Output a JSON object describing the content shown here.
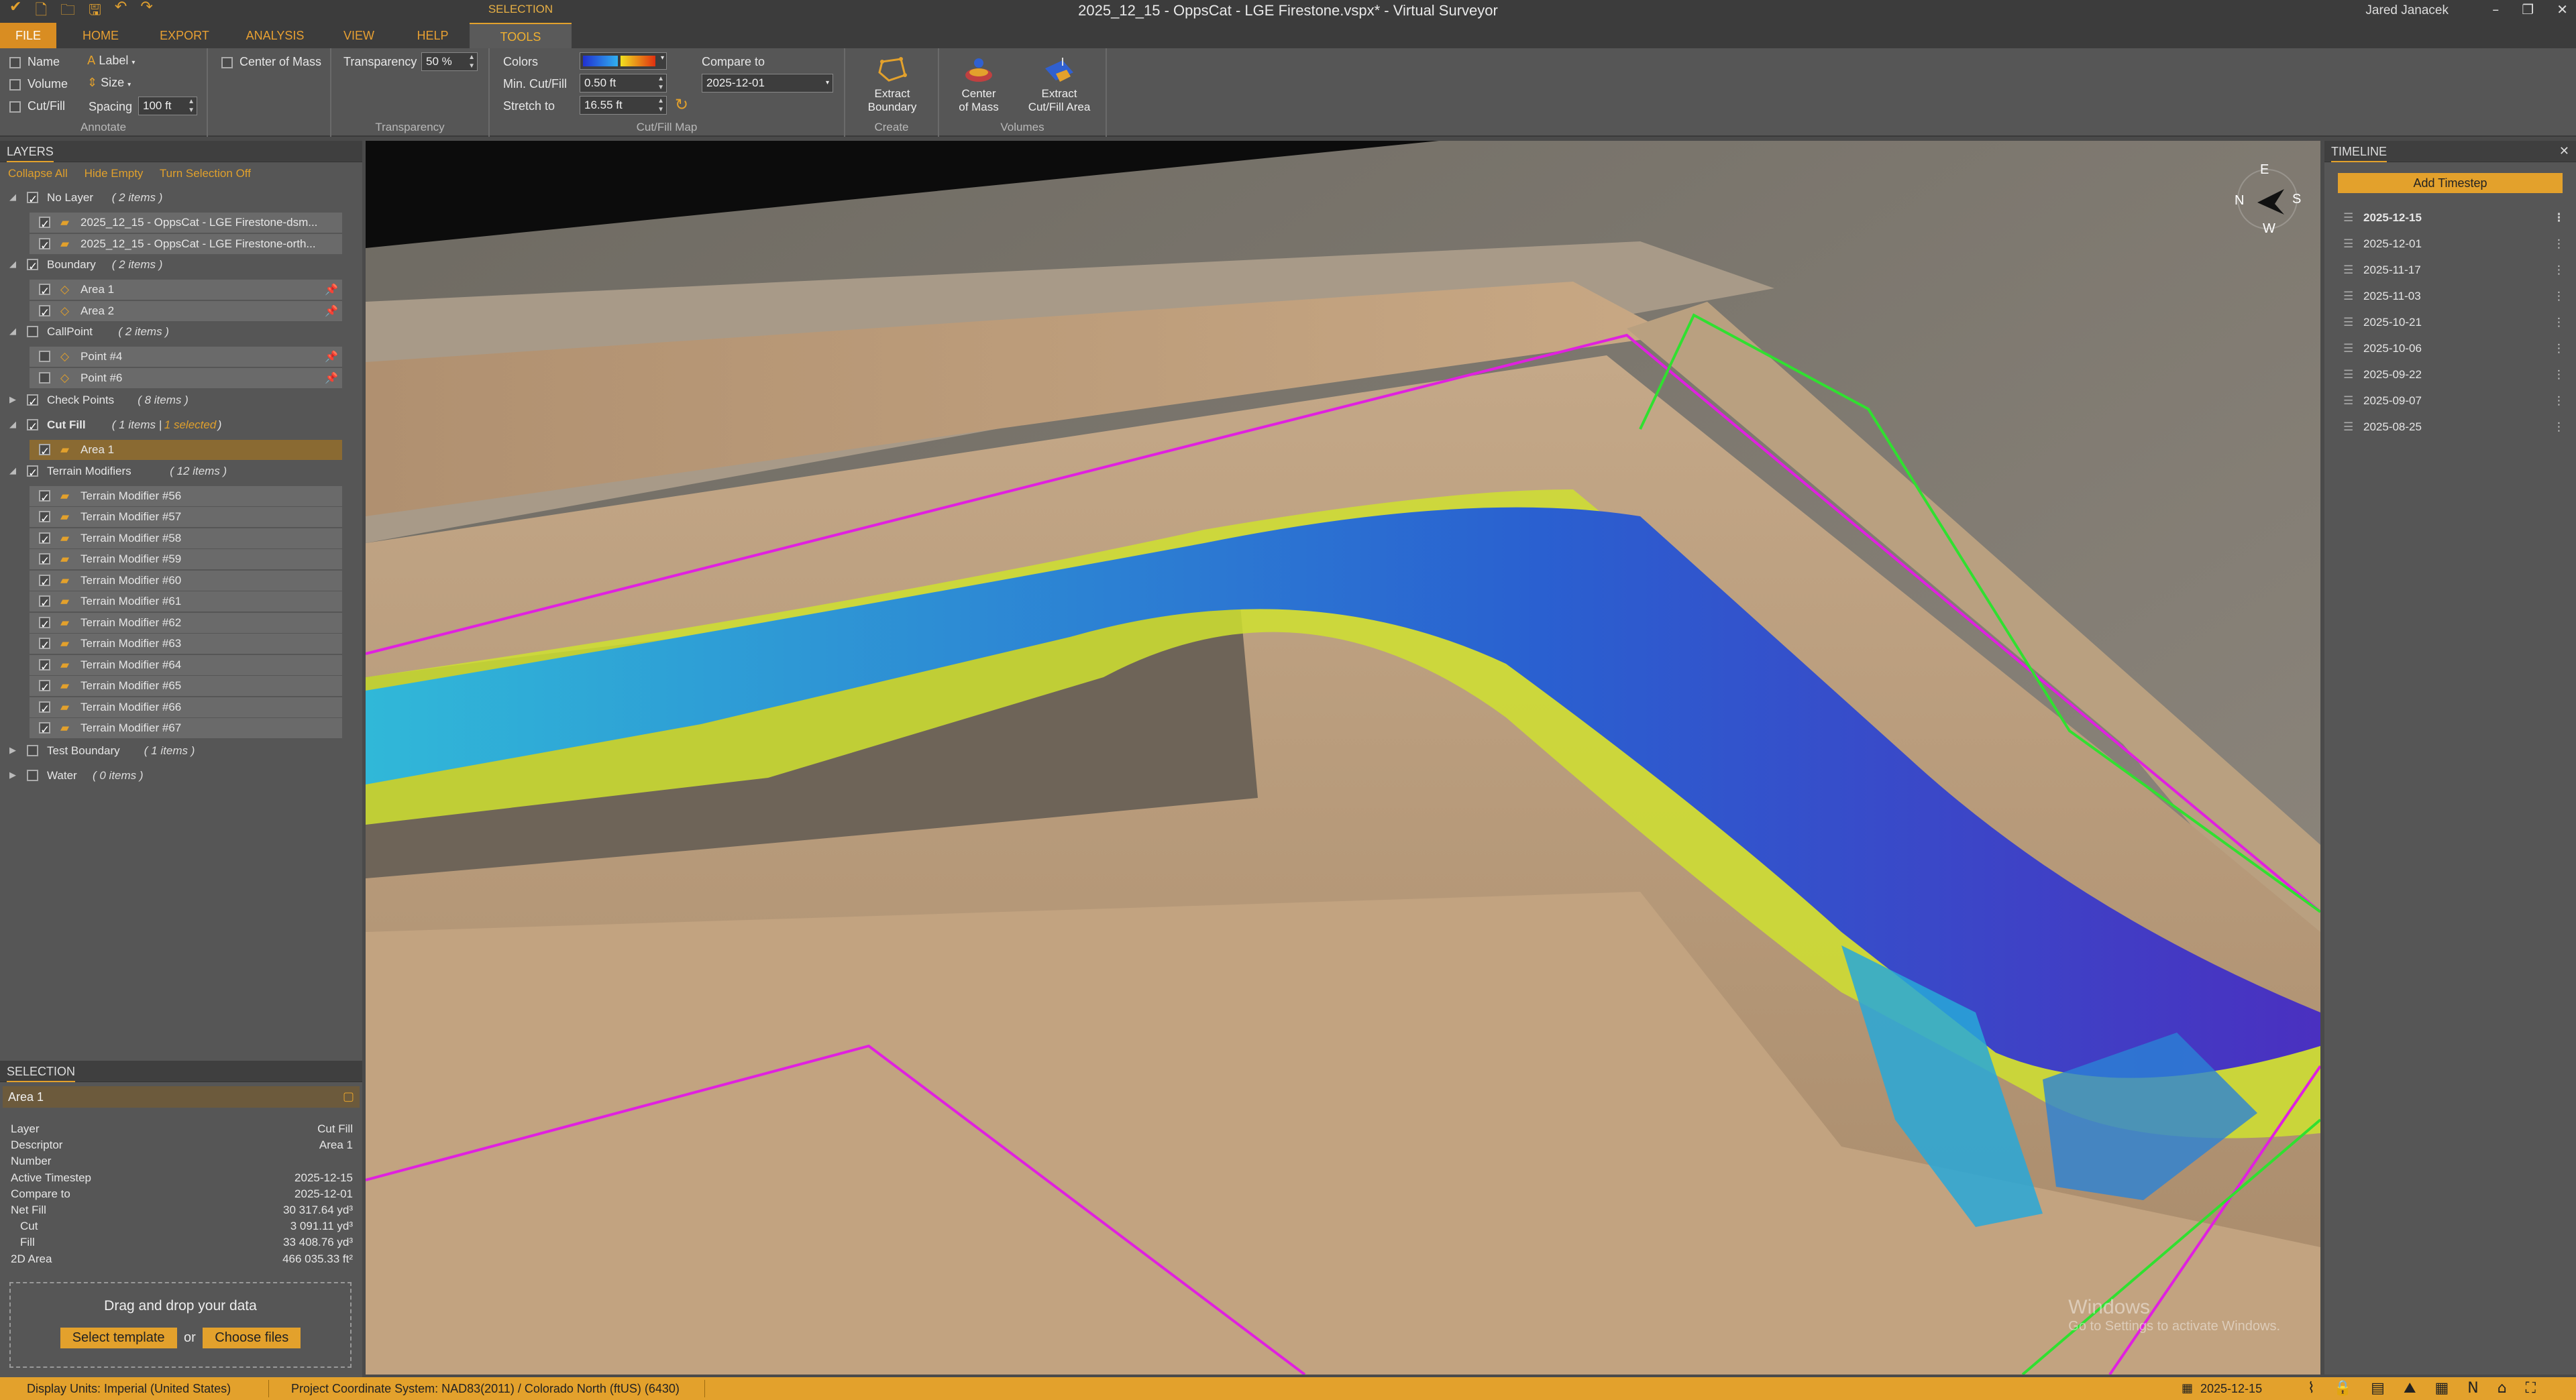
{
  "window": {
    "title": "2025_12_15 - OppsCat - LGE Firestone.vspx* - Virtual Surveyor",
    "user": "Jared Janacek",
    "context_tab": "SELECTION"
  },
  "tabs": [
    "FILE",
    "HOME",
    "EXPORT",
    "ANALYSIS",
    "VIEW",
    "HELP",
    "TOOLS"
  ],
  "ribbon": {
    "annotate": {
      "name": "Name",
      "volume": "Volume",
      "cutfill": "Cut/Fill",
      "label": "Label",
      "size": "Size",
      "spacing_label": "Spacing",
      "spacing_value": "100 ft",
      "center_of_mass": "Center of Mass",
      "group": "Annotate"
    },
    "transparency": {
      "label": "Transparency",
      "value": "50 %",
      "group": "Transparency"
    },
    "cutfill_map": {
      "colors": "Colors",
      "min_label": "Min. Cut/Fill",
      "min_value": "0.50 ft",
      "stretch_label": "Stretch to",
      "stretch_value": "16.55 ft",
      "compare_label": "Compare to",
      "compare_value": "2025-12-01",
      "group": "Cut/Fill Map"
    },
    "create": {
      "extract_boundary": [
        "Extract",
        "Boundary"
      ],
      "group": "Create"
    },
    "volumes": {
      "center_of_mass": [
        "Center",
        "of Mass"
      ],
      "extract_cutfill": [
        "Extract",
        "Cut/Fill Area"
      ],
      "group": "Volumes"
    }
  },
  "layers": {
    "header": "LAYERS",
    "links": [
      "Collapse All",
      "Hide Empty",
      "Turn Selection Off"
    ],
    "rows": [
      {
        "label": "No Layer",
        "count": "( 2 items )",
        "level": 0,
        "checked": true,
        "expanded": true
      },
      {
        "label": "2025_12_15 - OppsCat - LGE Firestone-dsm...",
        "level": 1,
        "checked": true
      },
      {
        "label": "2025_12_15 - OppsCat - LGE Firestone-orth...",
        "level": 1,
        "checked": true
      },
      {
        "label": "Boundary",
        "count": "( 2 items )",
        "level": 0,
        "checked": true,
        "expanded": true
      },
      {
        "label": "Area 1",
        "level": 1,
        "checked": true,
        "pin": true
      },
      {
        "label": "Area 2",
        "level": 1,
        "checked": true,
        "pin": true
      },
      {
        "label": "CallPoint",
        "count": "( 2 items )",
        "level": 0,
        "checked": false,
        "expanded": true
      },
      {
        "label": "Point #4",
        "level": 1,
        "checked": false,
        "pin": true
      },
      {
        "label": "Point #6",
        "level": 1,
        "checked": false,
        "pin": true
      },
      {
        "label": "Check Points",
        "count": "( 8 items )",
        "level": 0,
        "checked": true,
        "expanded": false
      },
      {
        "label": "Cut Fill",
        "count": "( 1 items |",
        "extra": "1 selected",
        "tail": ")",
        "level": 0,
        "checked": true,
        "expanded": true,
        "bold": true
      },
      {
        "label": "Area 1",
        "level": 1,
        "checked": true,
        "selected": true
      },
      {
        "label": "Terrain Modifiers",
        "count": "( 12 items )",
        "level": 0,
        "checked": true,
        "expanded": true
      },
      {
        "label": "Terrain Modifier #56",
        "level": 1,
        "checked": true
      },
      {
        "label": "Terrain Modifier #57",
        "level": 1,
        "checked": true
      },
      {
        "label": "Terrain Modifier #58",
        "level": 1,
        "checked": true
      },
      {
        "label": "Terrain Modifier #59",
        "level": 1,
        "checked": true
      },
      {
        "label": "Terrain Modifier #60",
        "level": 1,
        "checked": true
      },
      {
        "label": "Terrain Modifier #61",
        "level": 1,
        "checked": true
      },
      {
        "label": "Terrain Modifier #62",
        "level": 1,
        "checked": true
      },
      {
        "label": "Terrain Modifier #63",
        "level": 1,
        "checked": true
      },
      {
        "label": "Terrain Modifier #64",
        "level": 1,
        "checked": true
      },
      {
        "label": "Terrain Modifier #65",
        "level": 1,
        "checked": true
      },
      {
        "label": "Terrain Modifier #66",
        "level": 1,
        "checked": true
      },
      {
        "label": "Terrain Modifier #67",
        "level": 1,
        "checked": true
      },
      {
        "label": "Test Boundary",
        "count": "( 1 items )",
        "level": 0,
        "checked": false,
        "expanded": false
      },
      {
        "label": "Water",
        "count": "( 0 items )",
        "level": 0,
        "checked": false,
        "expanded": false
      }
    ]
  },
  "selection": {
    "header": "SELECTION",
    "name": "Area 1",
    "props": [
      {
        "k": "Layer",
        "v": "Cut Fill"
      },
      {
        "k": "Descriptor",
        "v": "Area 1"
      },
      {
        "k": "Number",
        "v": ""
      },
      {
        "k": "Active Timestep",
        "v": "2025-12-15"
      },
      {
        "k": "Compare to",
        "v": "2025-12-01"
      },
      {
        "k": "Net Fill",
        "v": "30 317.64 yd³"
      },
      {
        "k": "Cut",
        "v": "3 091.11 yd³",
        "indent": true
      },
      {
        "k": "Fill",
        "v": "33 408.76 yd³",
        "indent": true
      },
      {
        "k": "2D Area",
        "v": "466 035.33 ft²"
      }
    ],
    "drop": {
      "text": "Drag and drop your data",
      "template": "Select template",
      "or": "or",
      "files": "Choose files"
    }
  },
  "map": {
    "compass": {
      "n": "N",
      "e": "E",
      "s": "S",
      "w": "W"
    },
    "watermark": {
      "line1": "Windows",
      "line2": "Go to Settings to activate Windows."
    }
  },
  "timeline": {
    "header": "TIMELINE",
    "add": "Add Timestep",
    "dates": [
      "2025-12-15",
      "2025-12-01",
      "2025-11-17",
      "2025-11-03",
      "2025-10-21",
      "2025-10-06",
      "2025-09-22",
      "2025-09-07",
      "2025-08-25"
    ]
  },
  "status": {
    "units": "Display Units:  Imperial (United States)",
    "crs": "Project Coordinate System:  NAD83(2011) / Colorado North (ftUS) (6430)",
    "date": "2025-12-15"
  }
}
